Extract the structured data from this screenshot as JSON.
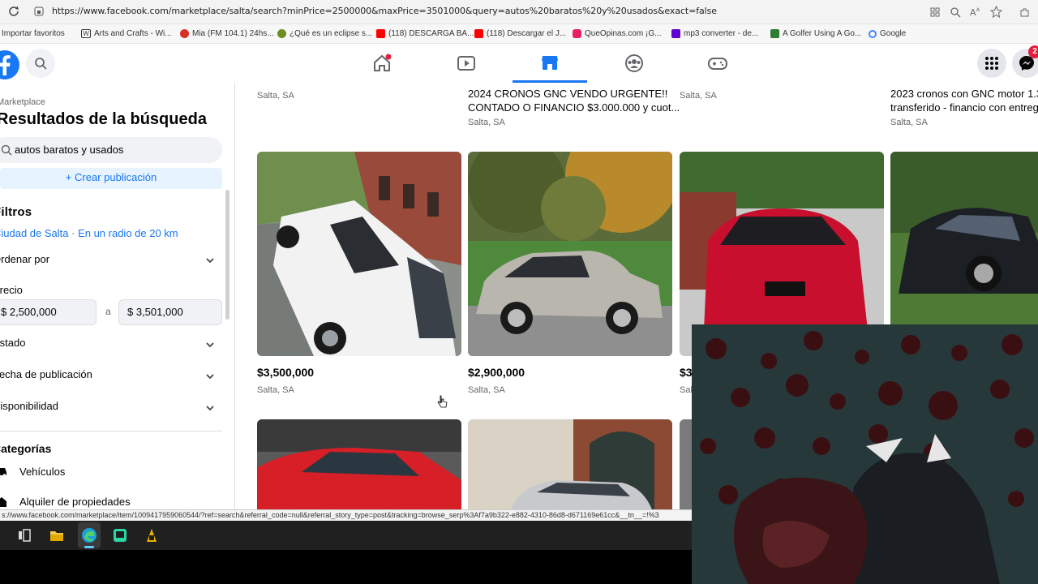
{
  "browser": {
    "url": "https://www.facebook.com/marketplace/salta/search?minPrice=2500000&maxPrice=3501000&query=autos%20baratos%20y%20usados&exact=false",
    "bookmarks": [
      {
        "label": "Importar favoritos",
        "color": "#0078d4"
      },
      {
        "label": "Arts and Crafts - Wi...",
        "color": "#222222"
      },
      {
        "label": "Mia (FM 104.1) 24hs...",
        "color": "#d93025"
      },
      {
        "label": "¿Qué es un eclipse s...",
        "color": "#6b8e23"
      },
      {
        "label": "(118) DESCARGA BA...",
        "color": "#ff0000"
      },
      {
        "label": "(118) Descargar el J...",
        "color": "#ff0000"
      },
      {
        "label": "QueOpinas.com ¡G...",
        "color": "#e91e63"
      },
      {
        "label": "mp3 converter - de...",
        "color": "#6001d2"
      },
      {
        "label": "A Golfer Using A Go...",
        "color": "#2e7d32"
      },
      {
        "label": "Google",
        "color": "#4285f4"
      }
    ]
  },
  "nav": {
    "messenger_badge": "2",
    "icons": [
      "home-icon",
      "watch-icon",
      "marketplace-icon",
      "groups-icon",
      "gaming-icon"
    ]
  },
  "sidebar": {
    "section": "Marketplace",
    "heading": "Resultados de la búsqueda",
    "search_value": "autos baratos y usados",
    "create_label": "+ Crear publicación",
    "filters_title": "Filtros",
    "location": "Ciudad de Salta · En un radio de 20 km",
    "sort_label": "Ordenar por",
    "price_label": "Precio",
    "price_min": "$ 2,500,000",
    "price_sep": "a",
    "price_max": "$ 3,501,000",
    "condition_label": "Estado",
    "date_label": "Fecha de publicación",
    "availability_label": "Disponibilidad",
    "categories_title": "Categorías",
    "categories": [
      {
        "label": "Vehículos",
        "icon": "car-icon"
      },
      {
        "label": "Alquiler de propiedades",
        "icon": "home-icon"
      }
    ]
  },
  "listings_top": [
    {
      "title_line1": "",
      "title_line2": "",
      "location": "Salta, SA"
    },
    {
      "title_line1": "2024 CRONOS GNC VENDO URGENTE!!",
      "title_line2": "CONTADO O FINANCIO $3.000.000 y cuot...",
      "location": "Salta, SA"
    },
    {
      "title_line1": "",
      "title_line2": "",
      "location": "Salta, SA"
    },
    {
      "title_line1": "2023 cronos con GNC motor 1.3",
      "title_line2": "transferido - financio con entreg",
      "location": "Salta, SA"
    }
  ],
  "listings": [
    {
      "price": "$3,500,000",
      "location": "Salta, SA",
      "car_color": "#f2f2f2"
    },
    {
      "price": "$2,900,000",
      "location": "Salta, SA",
      "car_color": "#b9b6ad"
    },
    {
      "price": "$3",
      "location": "Sal",
      "car_color": "#c8102e"
    },
    {
      "price": "",
      "location": "",
      "car_color": "#1c1f24"
    }
  ],
  "status": {
    "link": "s://www.facebook.com/marketplace/item/1009417959060544/?ref=search&referral_code=null&referral_story_type=post&tracking=browse_serp%3Af7a9b322-e882-4310-86d8-d671169e61cc&__tn__=!%3"
  }
}
